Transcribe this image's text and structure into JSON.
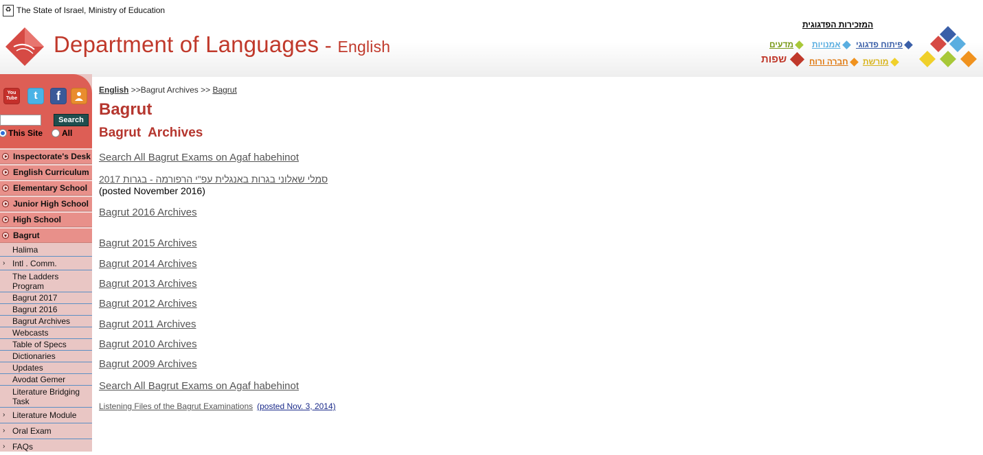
{
  "header": {
    "state_line": "The State of Israel, Ministry of Education",
    "dept_title": "Department of Languages",
    "dept_sep": " - ",
    "dept_subtitle": "English",
    "ped_title": "המזכירות הפדגוגית",
    "links": [
      {
        "label": "פיתוח פדגוגי",
        "color": "#3a5fa8"
      },
      {
        "label": "אמנויות",
        "color": "#5aaee0"
      },
      {
        "label": "מדעים",
        "color": "#7a9a1a"
      },
      {
        "label": "מורשת",
        "color": "#d8b41c"
      },
      {
        "label": "חברה ורוח",
        "color": "#e07a12"
      },
      {
        "label": "שפות",
        "color": "#c0392b"
      }
    ]
  },
  "sidebar": {
    "social": [
      {
        "icon": "youtube-icon",
        "text": "You Tube",
        "color": "#c4302b"
      },
      {
        "icon": "twitter-icon",
        "text": "t",
        "color": "#4ab3e6"
      },
      {
        "icon": "facebook-icon",
        "text": "f",
        "color": "#3b5998"
      },
      {
        "icon": "contact-icon",
        "text": "",
        "color": "#e98c2e"
      }
    ],
    "search": {
      "button_label": "Search",
      "placeholder": "",
      "radio_site": "This Site",
      "radio_all": "All"
    },
    "main_items": [
      {
        "label": "Inspectorate's Desk",
        "open": false
      },
      {
        "label": "English Curriculum",
        "open": false
      },
      {
        "label": "Elementary School",
        "open": false
      },
      {
        "label": "Junior High School",
        "open": false
      },
      {
        "label": "High School",
        "open": false
      },
      {
        "label": "Bagrut",
        "open": true
      }
    ],
    "sub_items": [
      {
        "label": "Halima",
        "arrow": false
      },
      {
        "label": "Intl . Comm.",
        "arrow": true
      },
      {
        "label": "The Ladders Program",
        "arrow": false
      },
      {
        "label": "Bagrut 2017",
        "arrow": false
      },
      {
        "label": "Bagrut 2016",
        "arrow": false
      },
      {
        "label": "Bagrut Archives",
        "arrow": false
      },
      {
        "label": "Webcasts",
        "arrow": false
      },
      {
        "label": "Table of Specs",
        "arrow": false
      },
      {
        "label": "Dictionaries",
        "arrow": false
      },
      {
        "label": "Updates",
        "arrow": false
      },
      {
        "label": "Avodat Gemer",
        "arrow": false
      },
      {
        "label": "Literature Bridging Task",
        "arrow": false
      },
      {
        "label": "Literature Module",
        "arrow": true
      },
      {
        "label": "Oral Exam",
        "arrow": true
      },
      {
        "label": "FAQs",
        "arrow": true
      }
    ]
  },
  "breadcrumb": {
    "home": "English",
    "sep1": ">>",
    "middle": "Bagrut Archives",
    "sep2": ">>",
    "current": "Bagrut"
  },
  "main": {
    "title": "Bagrut",
    "subtitle": "Bagrut  Archives",
    "link_search_1": "Search All Bagrut Exams on Agaf habehinot",
    "link_hebrew": "סמלי שאלוני בגרות באנגלית עפ\"י הרפורמה - בגרות 2017",
    "posted_note": "(posted November 2016)",
    "archives": [
      "Bagrut 2016 Archives",
      "Bagrut 2015 Archives",
      "Bagrut 2014 Archives",
      "Bagrut 2013 Archives",
      "Bagrut 2012 Archives",
      "Bagrut 2011 Archives",
      "Bagrut 2010 Archives",
      "Bagrut 2009 Archives"
    ],
    "link_search_2": "Search All Bagrut Exams on Agaf habehinot",
    "listening_label": "Listening Files of the Bagrut Examinations",
    "listening_posted": "(posted Nov. 3, 2014)"
  }
}
